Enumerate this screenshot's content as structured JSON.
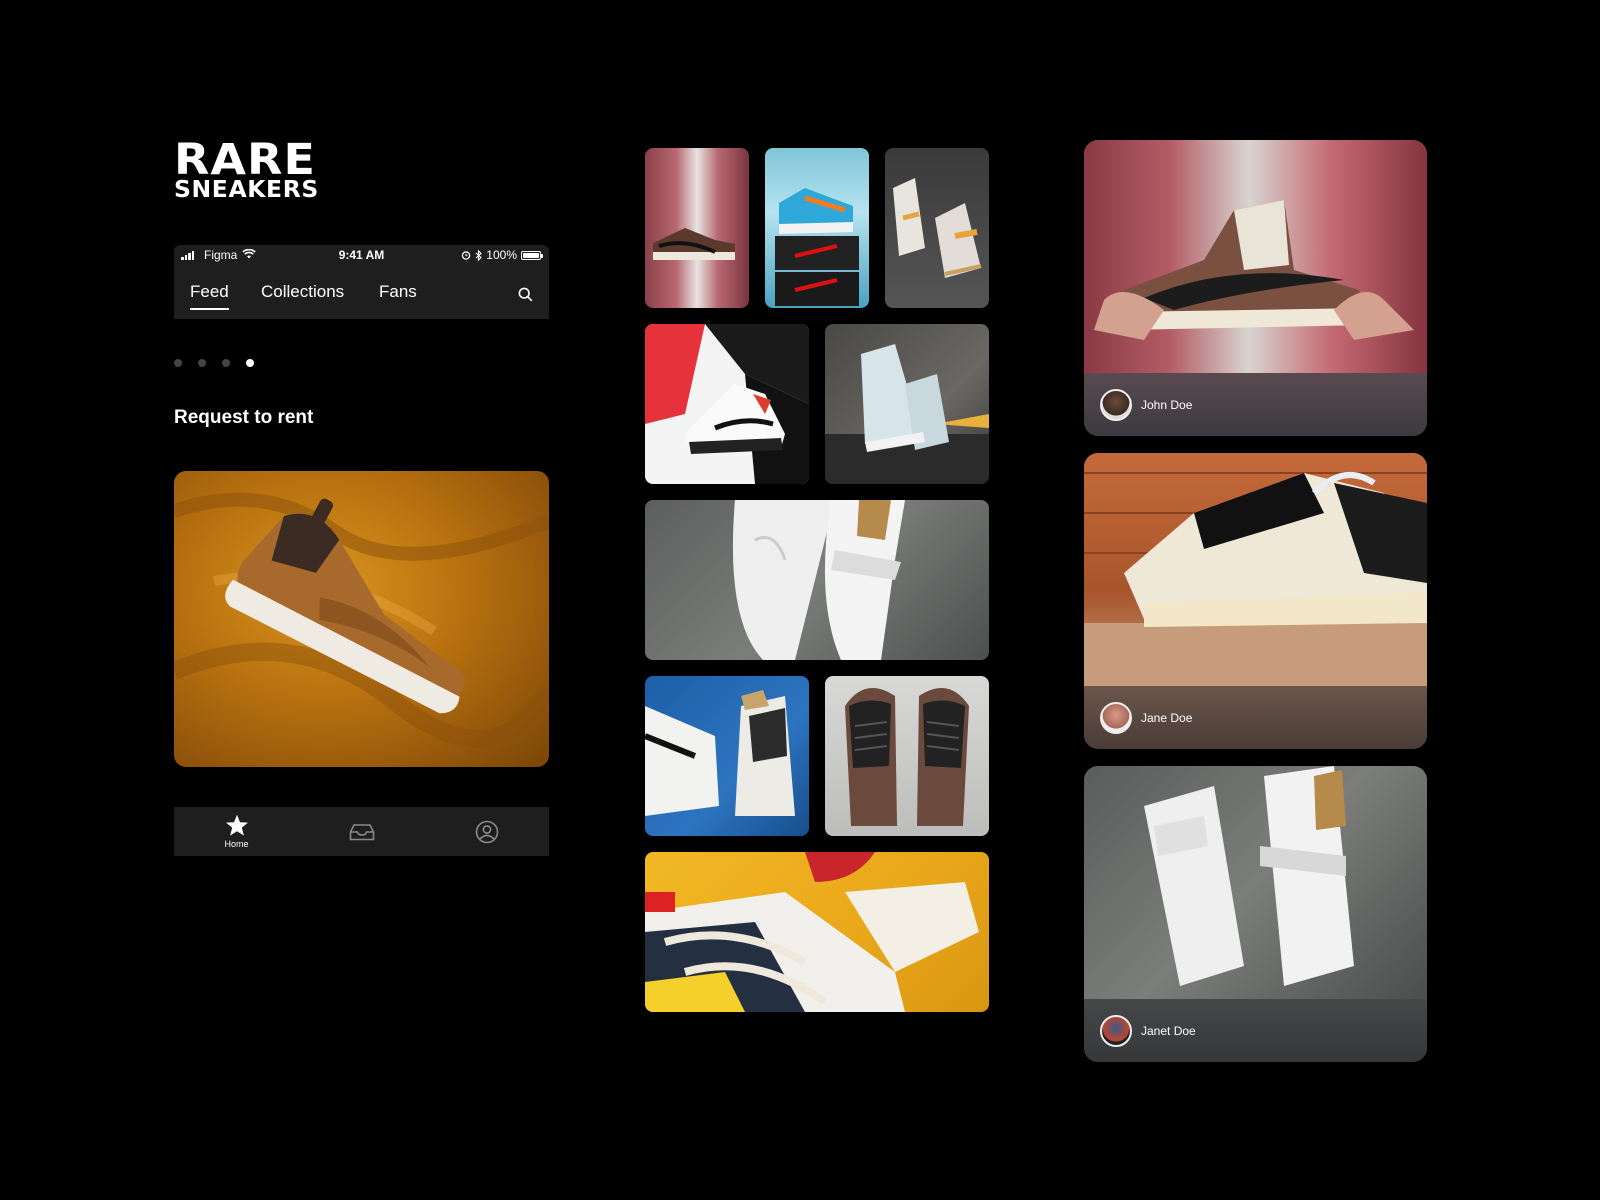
{
  "brand": {
    "line1": "RARE",
    "line2": "SNEAKERS"
  },
  "status_bar": {
    "carrier": "Figma",
    "time": "9:41 AM",
    "battery": "100%"
  },
  "tabs": [
    {
      "label": "Feed",
      "active": true
    },
    {
      "label": "Collections",
      "active": false
    },
    {
      "label": "Fans",
      "active": false
    }
  ],
  "icons": {
    "search": "search-icon",
    "home": "star-icon",
    "inbox": "inbox-icon",
    "profile": "user-circle-icon"
  },
  "carousel": {
    "pages": 4,
    "current": 4
  },
  "section_title": "Request to rent",
  "bottom_nav": {
    "home_label": "Home"
  },
  "cards": [
    {
      "user": "John Doe"
    },
    {
      "user": "Jane Doe"
    },
    {
      "user": "Janet Doe"
    }
  ],
  "colors": {
    "background": "#000000",
    "surface": "#1e1e1e",
    "text": "#ffffff",
    "dot_inactive": "#444444"
  }
}
